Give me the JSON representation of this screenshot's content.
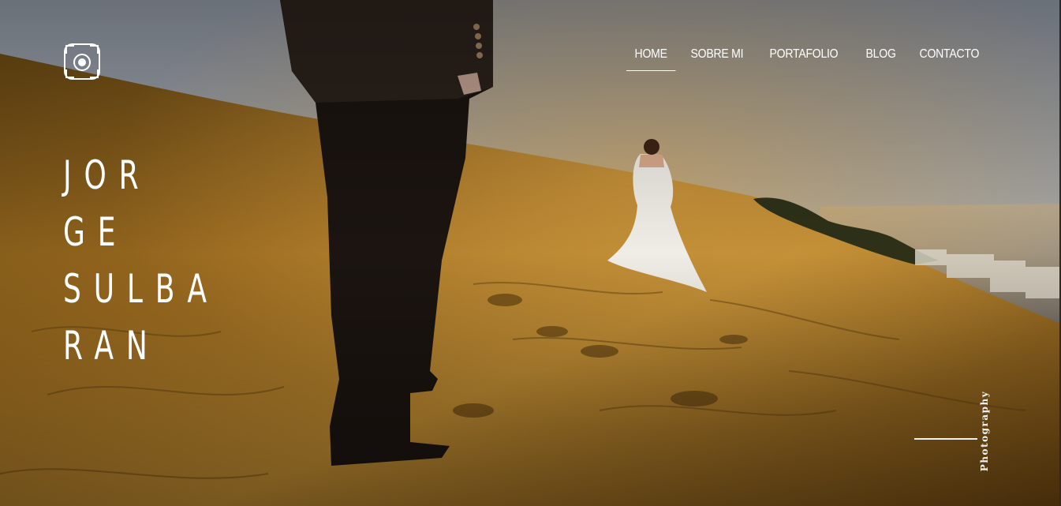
{
  "nav": {
    "items": [
      {
        "label": "HOME",
        "active": true
      },
      {
        "label": "SOBRE MI"
      },
      {
        "label": "PORTAFOLIO"
      },
      {
        "label": "BLOG"
      },
      {
        "label": "CONTACTO"
      }
    ]
  },
  "hero": {
    "title_lines": [
      "JOR",
      "GE",
      "SULBA",
      "RAN"
    ],
    "tagline": "Photography"
  },
  "logo": {
    "icon": "camera-lens-icon"
  },
  "colors": {
    "sand": "#b8862f",
    "sky": "#9ea6b2",
    "text": "#ffffff"
  }
}
